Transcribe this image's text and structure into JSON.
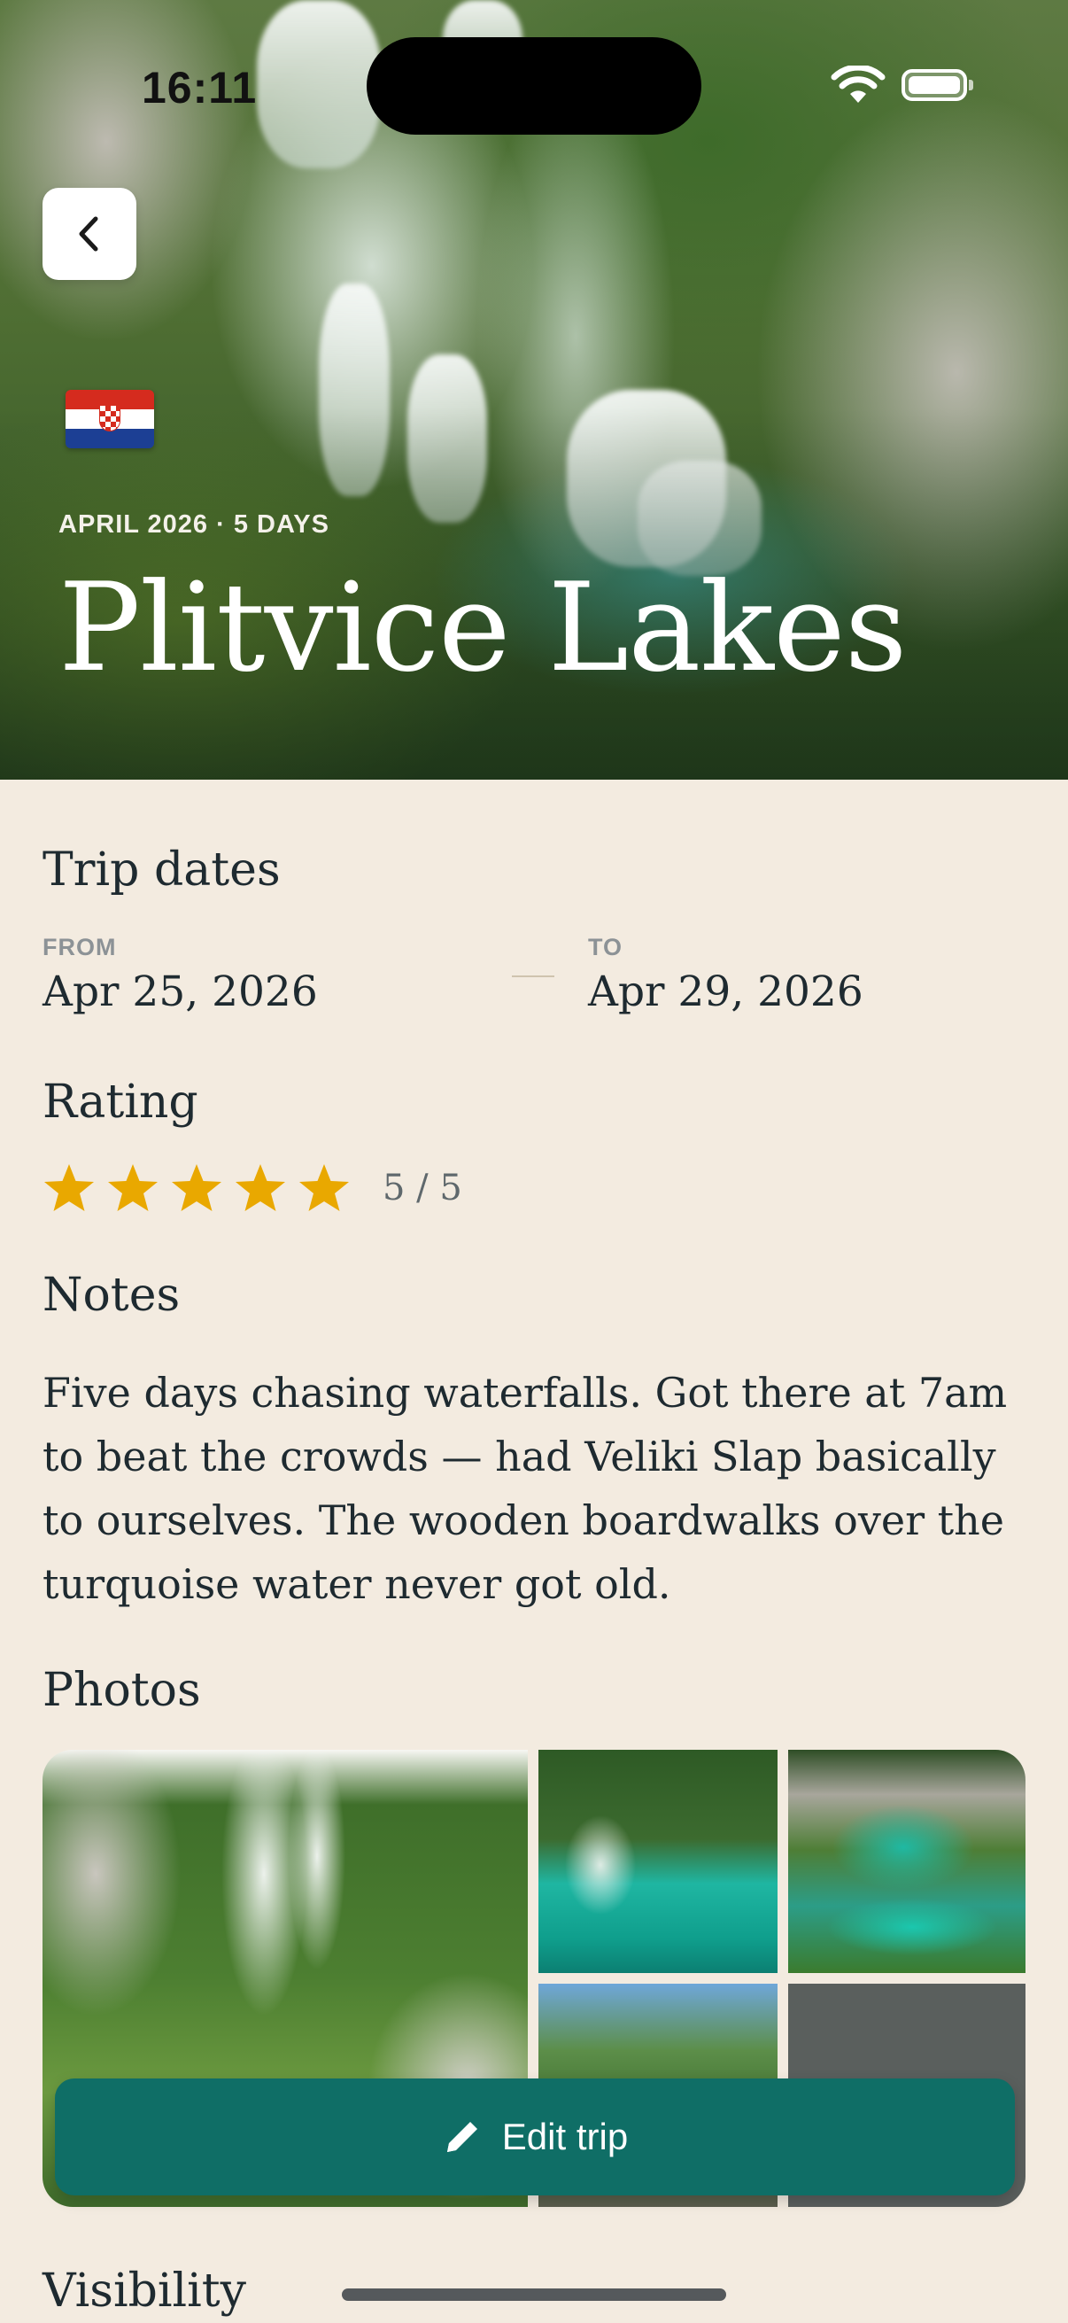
{
  "status_bar": {
    "time": "16:11"
  },
  "hero": {
    "meta": "APRIL 2026 · 5 DAYS",
    "title": "Plitvice Lakes",
    "flag": "croatia-flag-icon"
  },
  "trip_dates": {
    "heading": "Trip dates",
    "from_label": "FROM",
    "from_value": "Apr 25, 2026",
    "to_label": "TO",
    "to_value": "Apr 29, 2026"
  },
  "rating": {
    "heading": "Rating",
    "value": 5,
    "max": 5,
    "text": "5 / 5",
    "star_color": "#E9A800"
  },
  "notes": {
    "heading": "Notes",
    "text": "Five days chasing waterfalls. Got there at 7am to beat the crowds — had Veliki Slap basically to ourselves. The wooden boardwalks over the turquoise water never got old."
  },
  "photos": {
    "heading": "Photos",
    "count_shown": 5
  },
  "actions": {
    "edit_label": "Edit trip",
    "accent": "#0F6E66"
  },
  "visibility": {
    "heading": "Visibility"
  },
  "colors": {
    "background": "#F3EBE0",
    "text": "#1E2A30"
  }
}
